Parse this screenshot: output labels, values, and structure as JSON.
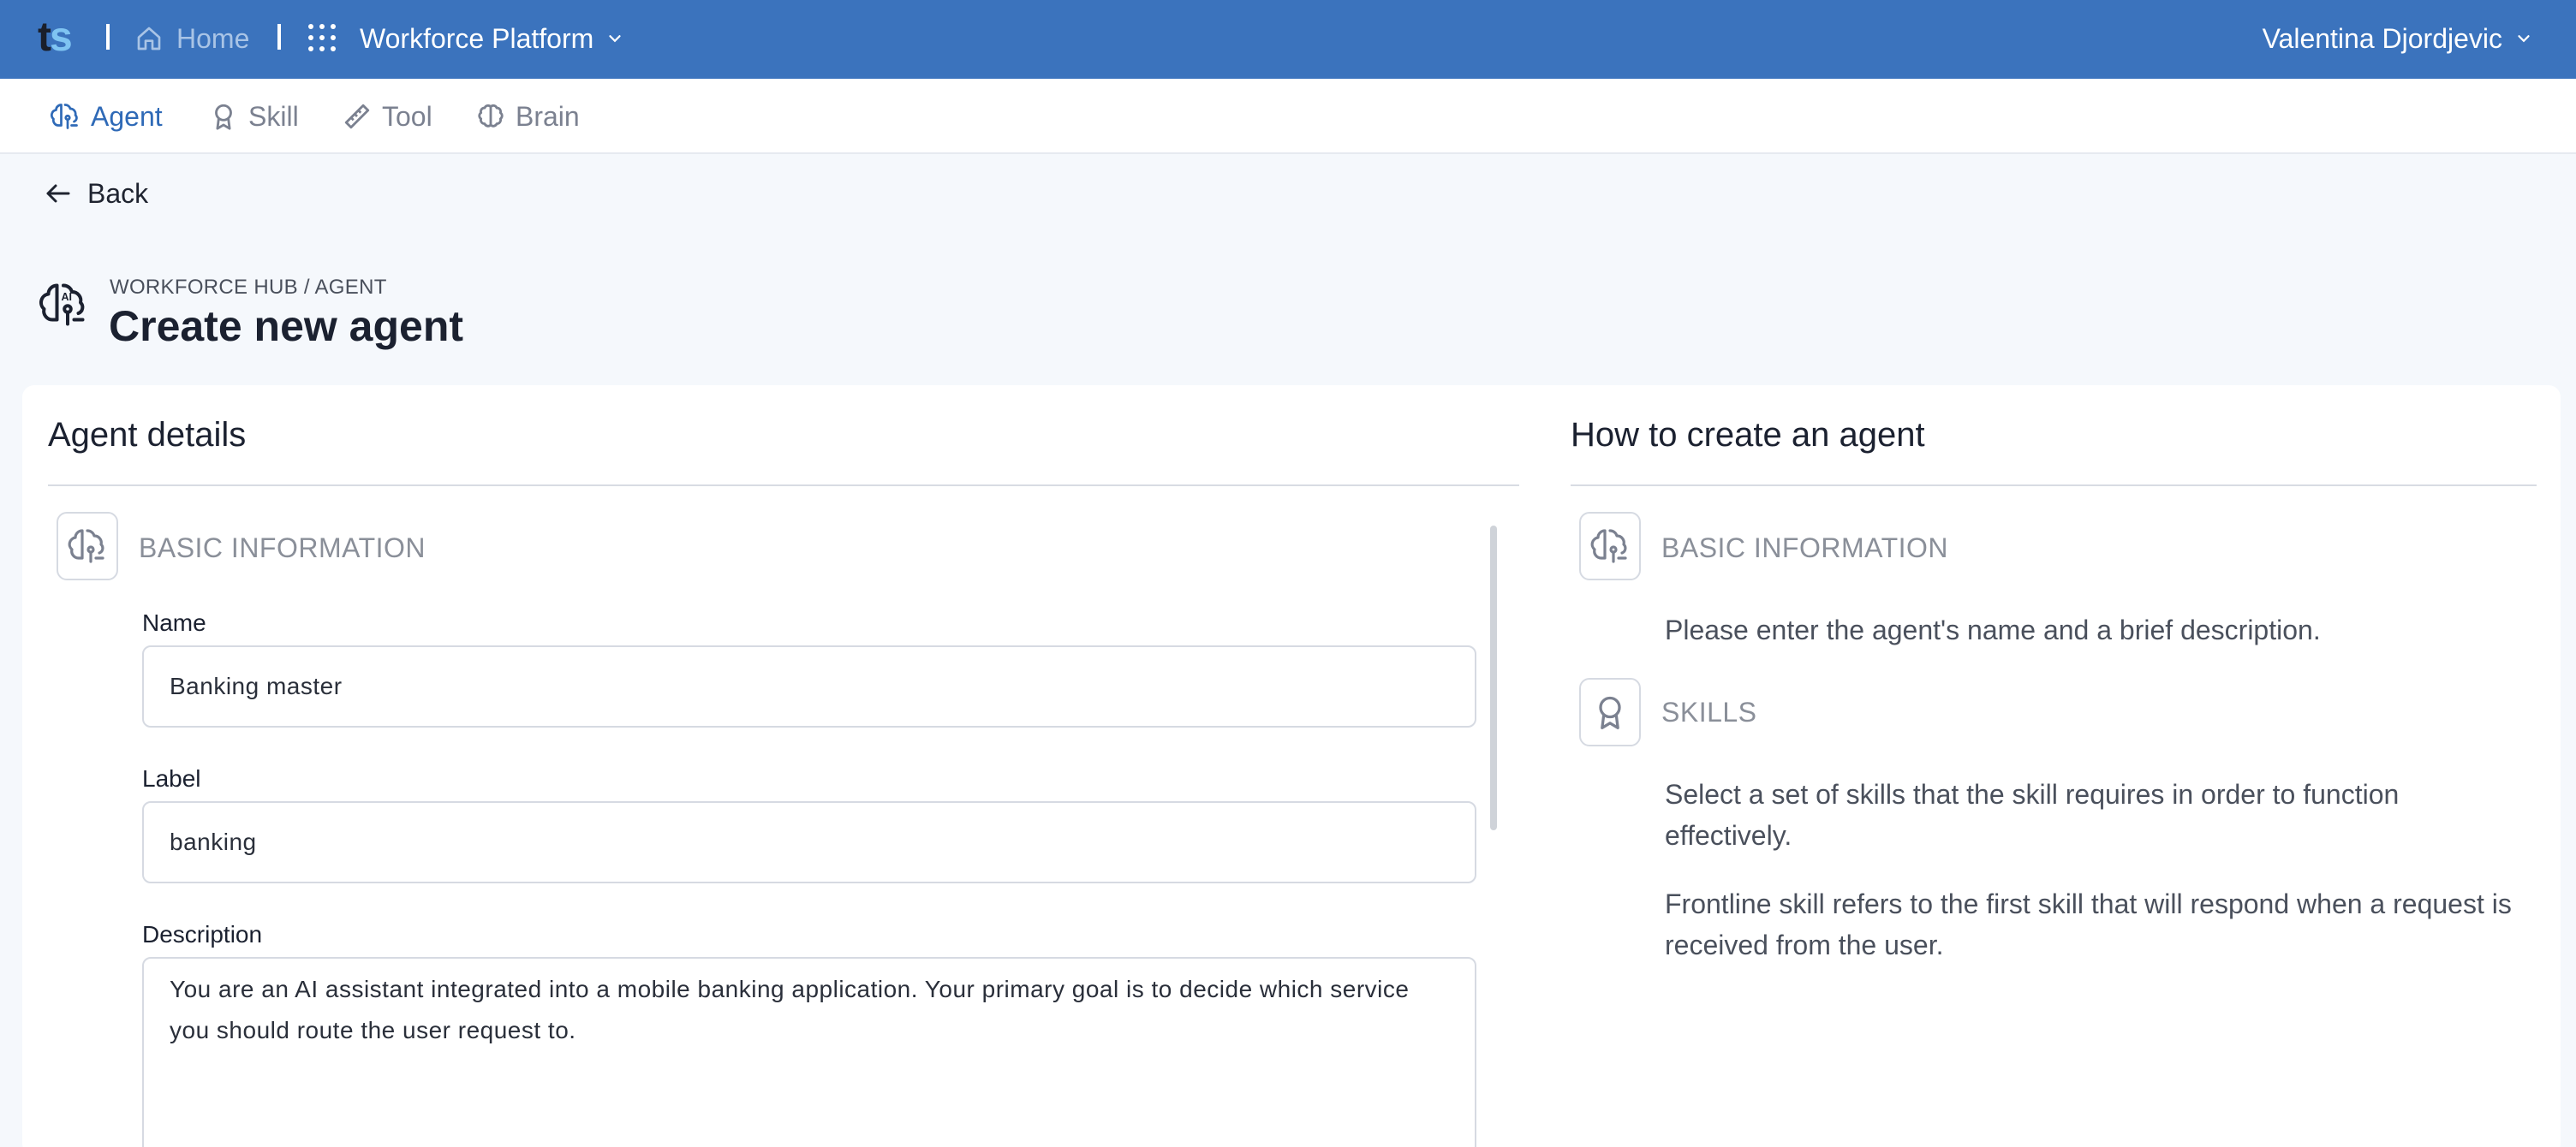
{
  "topbar": {
    "logo_t": "t",
    "logo_s": "s",
    "home_label": "Home",
    "platform_label": "Workforce Platform",
    "user_name": "Valentina Djordjevic"
  },
  "subnav": {
    "items": [
      {
        "label": "Agent",
        "icon": "agent-brain-icon",
        "active": true
      },
      {
        "label": "Skill",
        "icon": "badge-icon",
        "active": false
      },
      {
        "label": "Tool",
        "icon": "ruler-icon",
        "active": false
      },
      {
        "label": "Brain",
        "icon": "brain-icon",
        "active": false
      }
    ]
  },
  "back_label": "Back",
  "header": {
    "breadcrumb": "WORKFORCE HUB / AGENT",
    "title": "Create new agent"
  },
  "details": {
    "title": "Agent details",
    "group_title": "BASIC INFORMATION",
    "name_label": "Name",
    "name_value": "Banking master",
    "label_label": "Label",
    "label_value": "banking",
    "description_label": "Description",
    "description_value": "You are an AI assistant integrated into a mobile banking application. Your primary goal is to decide which service you should route the user request to."
  },
  "howto": {
    "title": "How to create an agent",
    "basic_title": "BASIC INFORMATION",
    "basic_text": "Please enter the agent's name and a brief description.",
    "skills_title": "SKILLS",
    "skills_text_1": "Select a set of skills that the skill requires in order to function effectively.",
    "skills_text_2": "Frontline skill refers to the first skill that will respond when a request is received from the user."
  },
  "colors": {
    "topbar": "#3b73bd",
    "accent": "#2f6ab7",
    "background": "#f5f8fc"
  }
}
